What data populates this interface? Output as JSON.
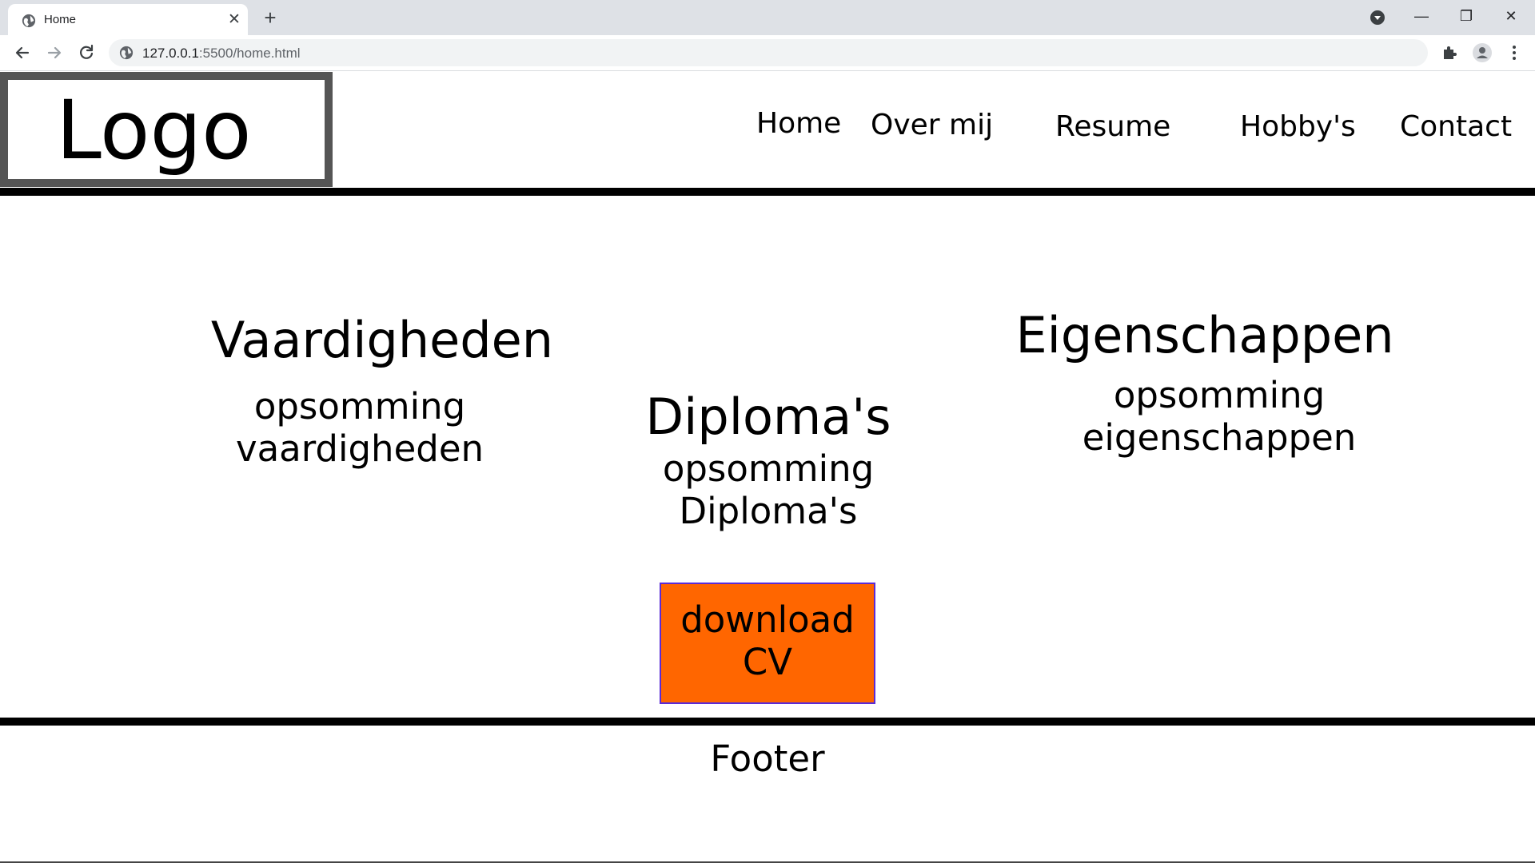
{
  "browser": {
    "tab_title": "Home",
    "tab_close_glyph": "✕",
    "new_tab_glyph": "+",
    "url_host": "127.0.0.1",
    "url_rest": ":5500/home.html",
    "window_minimize_glyph": "—",
    "window_restore_glyph": "❐",
    "window_close_glyph": "✕"
  },
  "header": {
    "logo": "Logo",
    "nav": {
      "home": "Home",
      "about": "Over mij",
      "resume": "Resume",
      "hobbies": "Hobby's",
      "contact": "Contact"
    }
  },
  "sections": {
    "skills": {
      "title": "Vaardigheden",
      "line1": "opsomming",
      "line2": "vaardigheden"
    },
    "diplomas": {
      "title": "Diploma's",
      "line1": "opsomming",
      "line2": "Diploma's"
    },
    "traits": {
      "title": "Eigenschappen",
      "line1": "opsomming",
      "line2": "eigenschappen"
    }
  },
  "download": {
    "line1": "download",
    "line2": "CV"
  },
  "footer": {
    "text": "Footer"
  },
  "colors": {
    "button_bg": "#ff6600",
    "button_border": "#5b2bd6",
    "rule": "#000000",
    "logo_border": "#555555"
  }
}
